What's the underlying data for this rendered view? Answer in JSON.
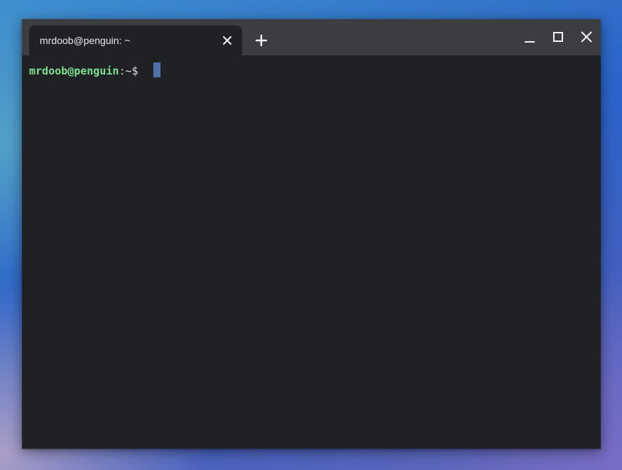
{
  "window": {
    "tab_title": "mrdoob@penguin: ~",
    "tab_close_icon": "close-icon",
    "new_tab_icon": "plus-icon",
    "minimize_icon": "minimize-icon",
    "maximize_icon": "maximize-icon",
    "close_icon": "close-icon"
  },
  "terminal": {
    "prompt_user_host": "mrdoob@penguin",
    "prompt_separator": ":",
    "prompt_path": "~",
    "prompt_symbol": "$ ",
    "input_text": ""
  },
  "colors": {
    "titlebar": "#3c3d40",
    "terminal_bg": "#202124",
    "prompt_user": "#7ee08f",
    "cursor": "#4f6fa8",
    "text": "#e8eaed"
  }
}
